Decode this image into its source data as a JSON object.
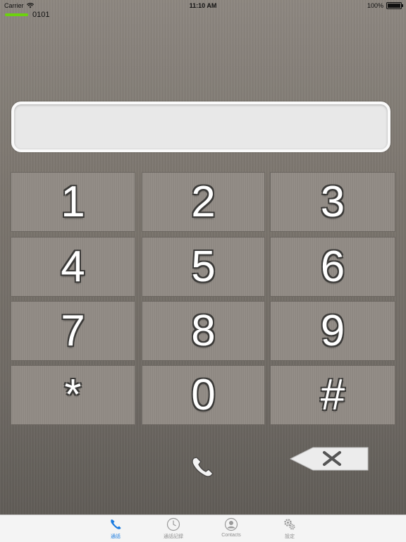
{
  "status_bar": {
    "carrier": "Carrier",
    "time": "11:10 AM",
    "battery": "100%"
  },
  "registration": {
    "number": "0101",
    "indicator_color": "#6cd20e"
  },
  "display": {
    "value": ""
  },
  "keypad": {
    "keys": [
      "1",
      "2",
      "3",
      "4",
      "5",
      "6",
      "7",
      "8",
      "9",
      "*",
      "0",
      "#"
    ]
  },
  "controls": {
    "call_icon": "phone-icon",
    "delete_icon": "backspace-icon"
  },
  "tab_bar": {
    "tabs": [
      {
        "label": "通話",
        "icon": "phone-icon",
        "active": true
      },
      {
        "label": "通話記録",
        "icon": "clock-icon",
        "active": false
      },
      {
        "label": "Contacts",
        "icon": "contact-icon",
        "active": false
      },
      {
        "label": "設定",
        "icon": "gear-icon",
        "active": false
      }
    ]
  },
  "colors": {
    "accent": "#1a7be0",
    "background": "#7b756e"
  }
}
